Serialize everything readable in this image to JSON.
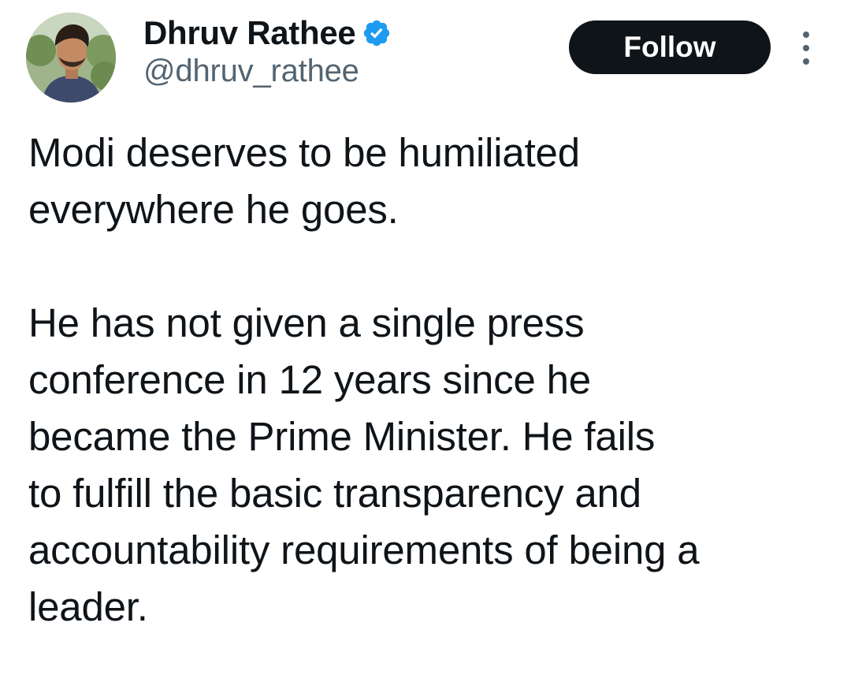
{
  "author": {
    "display_name": "Dhruv Rathee",
    "handle": "@dhruv_rathee",
    "verified": true,
    "verified_color": "#1d9bf0",
    "avatar_icon": "profile-photo"
  },
  "actions": {
    "follow_label": "Follow",
    "more_icon": "vertical-ellipsis-icon"
  },
  "tweet": {
    "paragraphs": [
      "Modi deserves to be humiliated\neverywhere he goes.",
      "He has not given a single press\nconference in 12 years since he\nbecame the Prime Minister. He fails\nto fulfill the basic transparency and\naccountability requirements of being a\nleader."
    ]
  },
  "colors": {
    "text_primary": "#0f1419",
    "text_secondary": "#536471",
    "button_bg": "#0f1419",
    "button_text": "#ffffff"
  }
}
